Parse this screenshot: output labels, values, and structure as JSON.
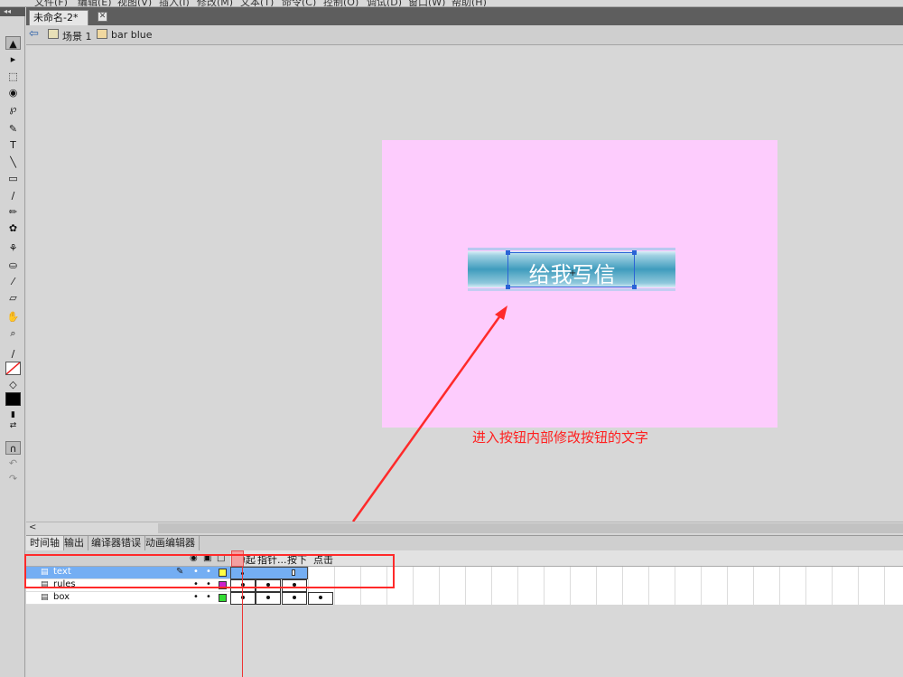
{
  "menubar": {
    "items": [
      "文件(F)",
      "编辑(E)",
      "视图(V)",
      "插入(I)",
      "修改(M)",
      "文本(T)",
      "命令(C)",
      "控制(O)",
      "调试(D)",
      "窗口(W)",
      "帮助(H)"
    ]
  },
  "tools": {
    "collapse": "◂◂",
    "icons": [
      "▲",
      "▸",
      "⬚",
      "◉",
      "℘",
      "✎",
      "T",
      "╲",
      "▭",
      "∕",
      "✏",
      "✿",
      "⚘",
      "⛀",
      "⁄",
      "▱",
      "✋",
      "⌕",
      "∕",
      "⬚",
      "◇",
      "■",
      "▮",
      "⇄",
      "∩",
      "↶",
      "↷"
    ]
  },
  "document": {
    "tab_title": "未命名-2*",
    "close_glyph": "✕"
  },
  "breadcrumbs": {
    "back_glyph": "⇦",
    "scene": "场景 1",
    "symbol": "bar blue"
  },
  "stage": {
    "button_text": "给我写信",
    "reg_mark": "+",
    "annotation": "进入按钮内部修改按钮的文字"
  },
  "scrollbar": {
    "left_arrow": "<"
  },
  "panel_tabs": [
    "时间轴",
    "输出",
    "编译器错误",
    "动画编辑器"
  ],
  "timeline": {
    "header_icons": {
      "eye": "◉",
      "lock": "▣",
      "outline": "□"
    },
    "frame_labels": [
      "弹起",
      "指针...",
      "按下",
      "点击"
    ],
    "layers": [
      {
        "name": "text",
        "color": "#ffff44",
        "selected": true,
        "pencil": "✎"
      },
      {
        "name": "rules",
        "color": "#cc22cc",
        "selected": false,
        "pencil": ""
      },
      {
        "name": "box",
        "color": "#33dd33",
        "selected": false,
        "pencil": ""
      }
    ],
    "layer_icon": "▤",
    "dot": "•"
  },
  "colors": {
    "stage_bg": "#fdccfd",
    "annotation": "#ff2020",
    "highlight": "#ff2a2a",
    "selection": "#74aef3"
  }
}
